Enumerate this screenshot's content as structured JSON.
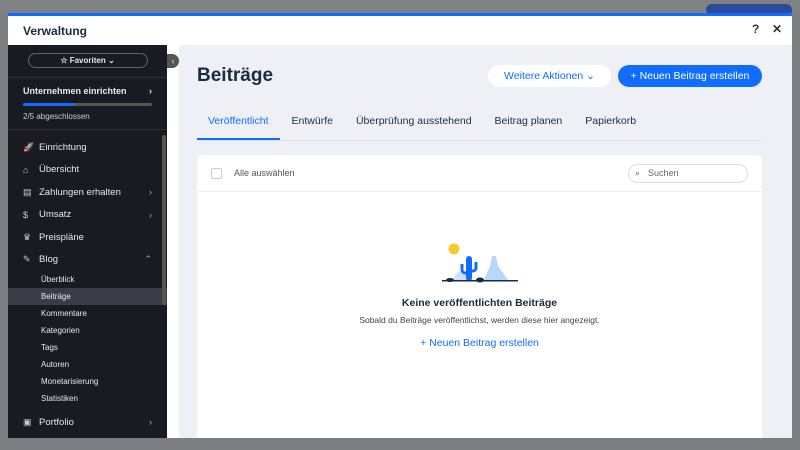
{
  "modal": {
    "title": "Verwaltung",
    "help": "?",
    "close": "✕"
  },
  "sidebar": {
    "favorites": "☆ Favoriten ⌄",
    "setup": {
      "title": "Unternehmen einrichten",
      "progress": 0.4,
      "status": "2/5 abgeschlossen"
    },
    "items": [
      {
        "label": "Einrichtung",
        "icon": "🚀",
        "chev": ""
      },
      {
        "label": "Übersicht",
        "icon": "⌂",
        "chev": ""
      },
      {
        "label": "Zahlungen erhalten",
        "icon": "▤",
        "chev": "›"
      },
      {
        "label": "Umsatz",
        "icon": "$",
        "chev": "›"
      },
      {
        "label": "Preispläne",
        "icon": "♛",
        "chev": ""
      },
      {
        "label": "Blog",
        "icon": "✎",
        "chev": "⌃"
      }
    ],
    "blog_sub": [
      "Überblick",
      "Beiträge",
      "Kommentare",
      "Kategorien",
      "Tags",
      "Autoren",
      "Monetarisierung",
      "Statistiken"
    ],
    "portfolio": {
      "label": "Portfolio",
      "icon": "▣",
      "chev": "›"
    }
  },
  "main": {
    "title": "Beiträge",
    "more_actions": "Weitere Aktionen ⌄",
    "new_post": "+  Neuen Beitrag erstellen",
    "tabs": [
      "Veröffentlicht",
      "Entwürfe",
      "Überprüfung ausstehend",
      "Beitrag planen",
      "Papierkorb"
    ],
    "select_all": "Alle auswählen",
    "search_placeholder": "Suchen",
    "empty_title": "Keine veröffentlichten Beiträge",
    "empty_sub": "Sobald du Beiträge veröffentlichst, werden diese hier angezeigt.",
    "empty_link": "+  Neuen Beitrag erstellen"
  }
}
